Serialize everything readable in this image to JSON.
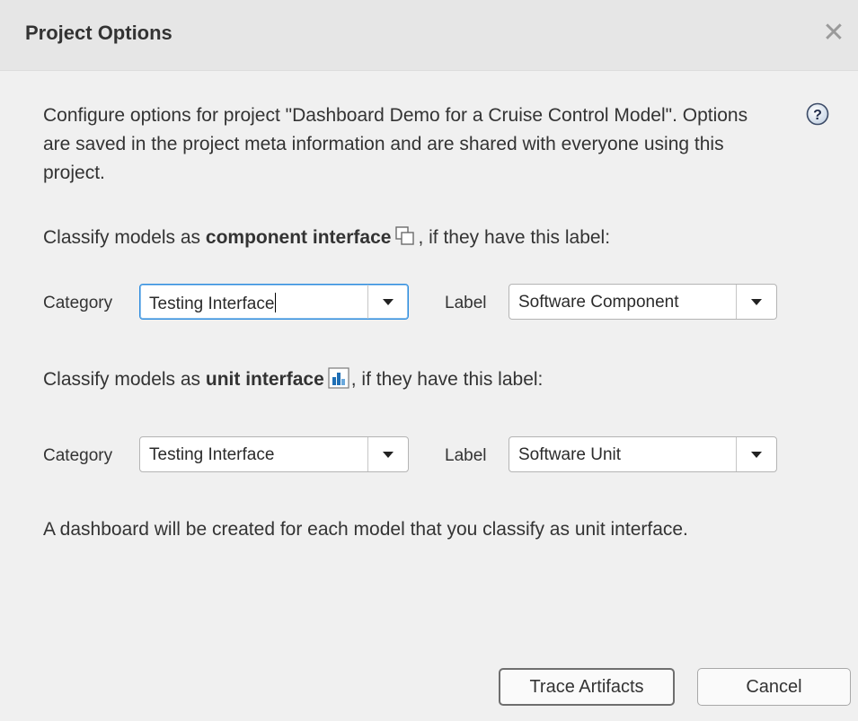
{
  "dialog": {
    "title": "Project Options",
    "close_icon": "close-icon",
    "help_icon": "help-icon"
  },
  "description": "Configure options for project \"Dashboard Demo for a Cruise Control Model\". Options are saved in the project meta information and are shared with everyone using this project.",
  "component": {
    "prefix": "Classify models as ",
    "bold": "component interface",
    "suffix": ", if they have this label:",
    "icon": "component-interface-icon",
    "category_label": "Category",
    "category_value": "Testing Interface",
    "label_label": "Label",
    "label_value": "Software Component"
  },
  "unit": {
    "prefix": "Classify models as ",
    "bold": "unit interface",
    "suffix": ", if they have this label:",
    "icon": "unit-interface-icon",
    "category_label": "Category",
    "category_value": "Testing Interface",
    "label_label": "Label",
    "label_value": "Software Unit"
  },
  "note": "A dashboard will be created for each model that you classify as unit interface.",
  "buttons": {
    "trace": "Trace Artifacts",
    "cancel": "Cancel"
  },
  "colors": {
    "focus_border": "#2d8cde",
    "unit_icon_blue": "#1f6fb5"
  }
}
